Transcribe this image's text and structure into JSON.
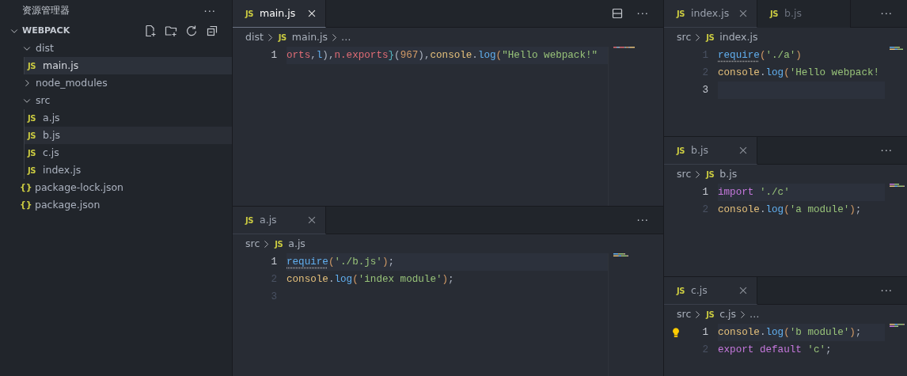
{
  "sidebar": {
    "title": "资源管理器",
    "more": "···",
    "section": {
      "title": "WEBPACK",
      "expanded": true
    },
    "tree": [
      {
        "label": "dist",
        "expanded": true,
        "selected": false,
        "children": [
          {
            "label": "main.js",
            "icon": "JS",
            "selected": true
          }
        ]
      },
      {
        "label": "node_modules",
        "expanded": false,
        "selected": false
      },
      {
        "label": "src",
        "expanded": true,
        "selected": false,
        "children": [
          {
            "label": "a.js",
            "icon": "JS",
            "selected": false
          },
          {
            "label": "b.js",
            "icon": "JS",
            "selected": false,
            "hovered": true
          },
          {
            "label": "c.js",
            "icon": "JS",
            "selected": false
          },
          {
            "label": "index.js",
            "icon": "JS",
            "selected": false
          }
        ]
      },
      {
        "label": "package-lock.json",
        "icon": "{}",
        "selected": false
      },
      {
        "label": "package.json",
        "icon": "{}",
        "selected": false
      }
    ]
  },
  "editor_columns": [
    [
      {
        "focused": true,
        "split_action": true,
        "more": "···",
        "tabs": [
          {
            "icon": "JS",
            "label": "main.js",
            "selected": true
          }
        ],
        "breadcrumb": [
          {
            "label": "dist"
          },
          {
            "icon": "JS",
            "label": "main.js"
          },
          {
            "label": "…"
          }
        ],
        "lines": [
          {
            "number": "1",
            "current": true,
            "tokens": [
              {
                "text": "orts",
                "kind": "var"
              },
              {
                "text": ",",
                "kind": "punc"
              },
              {
                "text": "l",
                "kind": "fn"
              },
              {
                "text": "),",
                "kind": "punc"
              },
              {
                "text": "n.exports",
                "kind": "var"
              },
              {
                "text": "}",
                "kind": "brace"
              },
              {
                "text": "(",
                "kind": "punc"
              },
              {
                "text": "967",
                "kind": "num"
              },
              {
                "text": "),",
                "kind": "punc"
              },
              {
                "text": "console",
                "kind": "obj"
              },
              {
                "text": ".",
                "kind": "punc"
              },
              {
                "text": "log",
                "kind": "fn"
              },
              {
                "text": "(",
                "kind": "paren"
              },
              {
                "text": "\"Hello webpack!\"",
                "kind": "str"
              }
            ]
          }
        ]
      },
      {
        "more": "···",
        "tabs": [
          {
            "icon": "JS",
            "label": "a.js",
            "selected": true
          }
        ],
        "breadcrumb": [
          {
            "label": "src"
          },
          {
            "icon": "JS",
            "label": "a.js"
          }
        ],
        "lines": [
          {
            "number": "1",
            "current": true,
            "tokens": [
              {
                "text": "require",
                "kind": "fn",
                "hint": true
              },
              {
                "text": "(",
                "kind": "paren"
              },
              {
                "text": "'./b.js'",
                "kind": "str"
              },
              {
                "text": ")",
                "kind": "paren"
              },
              {
                "text": ";",
                "kind": "punc"
              }
            ]
          },
          {
            "number": "2",
            "current": false,
            "tokens": [
              {
                "text": "console",
                "kind": "obj"
              },
              {
                "text": ".",
                "kind": "punc"
              },
              {
                "text": "log",
                "kind": "fn"
              },
              {
                "text": "(",
                "kind": "paren"
              },
              {
                "text": "'index module'",
                "kind": "str"
              },
              {
                "text": ")",
                "kind": "paren"
              },
              {
                "text": ";",
                "kind": "punc"
              }
            ]
          },
          {
            "number": "3",
            "current": false
          }
        ]
      }
    ],
    [
      {
        "more": "···",
        "tabs": [
          {
            "icon": "JS",
            "label": "index.js",
            "selected": true
          },
          {
            "icon": "JS",
            "label": "b.js",
            "selected": false
          }
        ],
        "breadcrumb": [
          {
            "label": "src"
          },
          {
            "icon": "JS",
            "label": "index.js"
          }
        ],
        "lines": [
          {
            "number": "1",
            "current": false,
            "tokens": [
              {
                "text": "require",
                "kind": "fn",
                "hint": true
              },
              {
                "text": "(",
                "kind": "paren"
              },
              {
                "text": "'./a'",
                "kind": "str"
              },
              {
                "text": ")",
                "kind": "paren"
              }
            ]
          },
          {
            "number": "2",
            "current": false,
            "tokens": [
              {
                "text": "console",
                "kind": "obj"
              },
              {
                "text": ".",
                "kind": "punc"
              },
              {
                "text": "log",
                "kind": "fn"
              },
              {
                "text": "(",
                "kind": "paren"
              },
              {
                "text": "'Hello webpack!",
                "kind": "str"
              }
            ]
          },
          {
            "number": "3",
            "current": true
          }
        ]
      },
      {
        "more": "···",
        "tabs": [
          {
            "icon": "JS",
            "label": "b.js",
            "selected": true
          }
        ],
        "breadcrumb": [
          {
            "label": "src"
          },
          {
            "icon": "JS",
            "label": "b.js"
          }
        ],
        "lines": [
          {
            "number": "1",
            "current": true,
            "tokens": [
              {
                "text": "import",
                "kind": "kw"
              },
              {
                "text": " './c'",
                "kind": "str"
              }
            ]
          },
          {
            "number": "2",
            "current": false,
            "tokens": [
              {
                "text": "console",
                "kind": "obj"
              },
              {
                "text": ".",
                "kind": "punc"
              },
              {
                "text": "log",
                "kind": "fn"
              },
              {
                "text": "(",
                "kind": "paren"
              },
              {
                "text": "'a module'",
                "kind": "str"
              },
              {
                "text": ")",
                "kind": "paren"
              },
              {
                "text": ";",
                "kind": "punc"
              }
            ]
          }
        ]
      },
      {
        "more": "···",
        "tabs": [
          {
            "icon": "JS",
            "label": "c.js",
            "selected": true
          }
        ],
        "breadcrumb": [
          {
            "label": "src"
          },
          {
            "icon": "JS",
            "label": "c.js"
          },
          {
            "label": "…"
          }
        ],
        "lines": [
          {
            "number": "1",
            "current": true,
            "lightbulb": true,
            "tokens": [
              {
                "text": "console",
                "kind": "obj"
              },
              {
                "text": ".",
                "kind": "punc"
              },
              {
                "text": "log",
                "kind": "fn"
              },
              {
                "text": "(",
                "kind": "paren"
              },
              {
                "text": "'b module'",
                "kind": "str"
              },
              {
                "text": ")",
                "kind": "paren"
              },
              {
                "text": ";",
                "kind": "punc"
              }
            ]
          },
          {
            "number": "2",
            "current": false,
            "tokens": [
              {
                "text": "export default",
                "kind": "kw"
              },
              {
                "text": " 'c'",
                "kind": "str"
              },
              {
                "text": ";",
                "kind": "punc"
              }
            ]
          }
        ]
      }
    ]
  ]
}
